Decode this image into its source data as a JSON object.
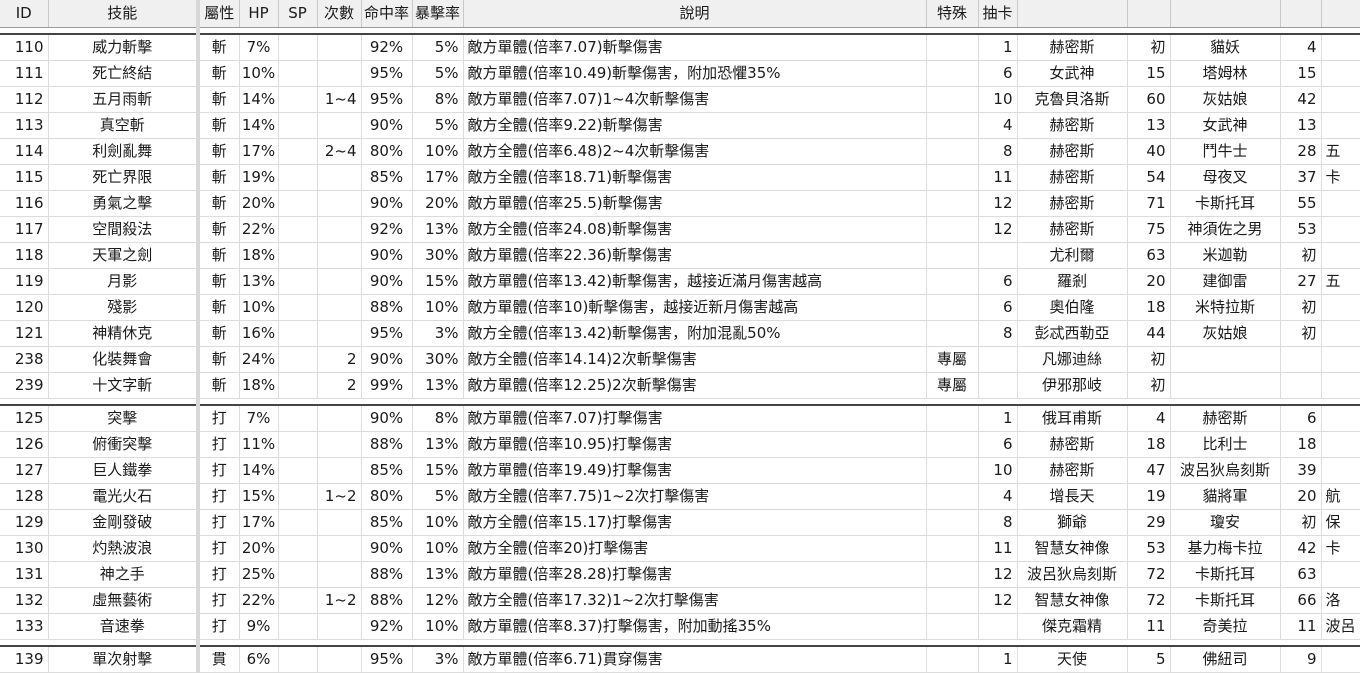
{
  "headers": [
    "ID",
    "技能",
    "屬性",
    "HP",
    "SP",
    "次數",
    "命中率",
    "暴擊率",
    "說明",
    "特殊",
    "抽卡",
    "",
    "",
    "",
    ""
  ],
  "groups": [
    [
      [
        "110",
        "威力斬擊",
        "斬",
        "7%",
        "",
        "",
        "92%",
        "5%",
        "敵方單體(倍率7.07)斬擊傷害",
        "",
        "1",
        "赫密斯",
        "初",
        "貓妖",
        "4",
        ""
      ],
      [
        "111",
        "死亡終結",
        "斬",
        "10%",
        "",
        "",
        "95%",
        "5%",
        "敵方單體(倍率10.49)斬擊傷害，附加恐懼35%",
        "",
        "6",
        "女武神",
        "15",
        "塔姆林",
        "15",
        ""
      ],
      [
        "112",
        "五月雨斬",
        "斬",
        "14%",
        "",
        "1~4",
        "95%",
        "8%",
        "敵方單體(倍率7.07)1~4次斬擊傷害",
        "",
        "10",
        "克魯貝洛斯",
        "60",
        "灰姑娘",
        "42",
        ""
      ],
      [
        "113",
        "真空斬",
        "斬",
        "14%",
        "",
        "",
        "90%",
        "5%",
        "敵方全體(倍率9.22)斬擊傷害",
        "",
        "4",
        "赫密斯",
        "13",
        "女武神",
        "13",
        ""
      ],
      [
        "114",
        "利劍亂舞",
        "斬",
        "17%",
        "",
        "2~4",
        "80%",
        "10%",
        "敵方全體(倍率6.48)2~4次斬擊傷害",
        "",
        "8",
        "赫密斯",
        "40",
        "鬥牛士",
        "28",
        "五"
      ],
      [
        "115",
        "死亡界限",
        "斬",
        "19%",
        "",
        "",
        "85%",
        "17%",
        "敵方全體(倍率18.71)斬擊傷害",
        "",
        "11",
        "赫密斯",
        "54",
        "母夜叉",
        "37",
        "卡"
      ],
      [
        "116",
        "勇氣之擊",
        "斬",
        "20%",
        "",
        "",
        "90%",
        "20%",
        "敵方單體(倍率25.5)斬擊傷害",
        "",
        "12",
        "赫密斯",
        "71",
        "卡斯托耳",
        "55",
        ""
      ],
      [
        "117",
        "空間殺法",
        "斬",
        "22%",
        "",
        "",
        "92%",
        "13%",
        "敵方全體(倍率24.08)斬擊傷害",
        "",
        "12",
        "赫密斯",
        "75",
        "神須佐之男",
        "53",
        ""
      ],
      [
        "118",
        "天軍之劍",
        "斬",
        "18%",
        "",
        "",
        "90%",
        "30%",
        "敵方單體(倍率22.36)斬擊傷害",
        "",
        "",
        "尤利爾",
        "63",
        "米迦勒",
        "初",
        ""
      ],
      [
        "119",
        "月影",
        "斬",
        "13%",
        "",
        "",
        "90%",
        "15%",
        "敵方單體(倍率13.42)斬擊傷害，越接近滿月傷害越高",
        "",
        "6",
        "羅剎",
        "20",
        "建御雷",
        "27",
        "五"
      ],
      [
        "120",
        "殘影",
        "斬",
        "10%",
        "",
        "",
        "88%",
        "10%",
        "敵方單體(倍率10)斬擊傷害，越接近新月傷害越高",
        "",
        "6",
        "奧伯隆",
        "18",
        "米特拉斯",
        "初",
        ""
      ],
      [
        "121",
        "神精休克",
        "斬",
        "16%",
        "",
        "",
        "95%",
        "3%",
        "敵方全體(倍率13.42)斬擊傷害，附加混亂50%",
        "",
        "8",
        "彭忒西勒亞",
        "44",
        "灰姑娘",
        "初",
        ""
      ],
      [
        "238",
        "化裝舞會",
        "斬",
        "24%",
        "",
        "2",
        "90%",
        "30%",
        "敵方全體(倍率14.14)2次斬擊傷害",
        "專屬",
        "",
        "凡娜迪絲",
        "初",
        "",
        "",
        ""
      ],
      [
        "239",
        "十文字斬",
        "斬",
        "18%",
        "",
        "2",
        "99%",
        "13%",
        "敵方單體(倍率12.25)2次斬擊傷害",
        "專屬",
        "",
        "伊邪那岐",
        "初",
        "",
        "",
        ""
      ]
    ],
    [
      [
        "125",
        "突擊",
        "打",
        "7%",
        "",
        "",
        "90%",
        "8%",
        "敵方單體(倍率7.07)打擊傷害",
        "",
        "1",
        "俄耳甫斯",
        "4",
        "赫密斯",
        "6",
        ""
      ],
      [
        "126",
        "俯衝突擊",
        "打",
        "11%",
        "",
        "",
        "88%",
        "13%",
        "敵方單體(倍率10.95)打擊傷害",
        "",
        "6",
        "赫密斯",
        "18",
        "比利士",
        "18",
        ""
      ],
      [
        "127",
        "巨人鐵拳",
        "打",
        "14%",
        "",
        "",
        "85%",
        "15%",
        "敵方單體(倍率19.49)打擊傷害",
        "",
        "10",
        "赫密斯",
        "47",
        "波呂狄烏刻斯",
        "39",
        ""
      ],
      [
        "128",
        "電光火石",
        "打",
        "15%",
        "",
        "1~2",
        "80%",
        "5%",
        "敵方全體(倍率7.75)1~2次打擊傷害",
        "",
        "4",
        "增長天",
        "19",
        "貓將軍",
        "20",
        "航"
      ],
      [
        "129",
        "金剛發破",
        "打",
        "17%",
        "",
        "",
        "85%",
        "10%",
        "敵方全體(倍率15.17)打擊傷害",
        "",
        "8",
        "獅爺",
        "29",
        "瓊安",
        "初",
        "保"
      ],
      [
        "130",
        "灼熱波浪",
        "打",
        "20%",
        "",
        "",
        "90%",
        "10%",
        "敵方全體(倍率20)打擊傷害",
        "",
        "11",
        "智慧女神像",
        "53",
        "基力梅卡拉",
        "42",
        "卡"
      ],
      [
        "131",
        "神之手",
        "打",
        "25%",
        "",
        "",
        "88%",
        "13%",
        "敵方單體(倍率28.28)打擊傷害",
        "",
        "12",
        "波呂狄烏刻斯",
        "72",
        "卡斯托耳",
        "63",
        ""
      ],
      [
        "132",
        "虛無藝術",
        "打",
        "22%",
        "",
        "1~2",
        "88%",
        "12%",
        "敵方全體(倍率17.32)1~2次打擊傷害",
        "",
        "12",
        "智慧女神像",
        "72",
        "卡斯托耳",
        "66",
        "洛"
      ],
      [
        "133",
        "音速拳",
        "打",
        "9%",
        "",
        "",
        "92%",
        "10%",
        "敵方單體(倍率8.37)打擊傷害，附加動搖35%",
        "",
        "",
        "傑克霜精",
        "11",
        "奇美拉",
        "11",
        "波呂"
      ]
    ],
    [
      [
        "139",
        "單次射擊",
        "貫",
        "6%",
        "",
        "",
        "95%",
        "3%",
        "敵方單體(倍率6.71)貫穿傷害",
        "",
        "1",
        "天使",
        "5",
        "佛紐司",
        "9",
        ""
      ]
    ]
  ]
}
